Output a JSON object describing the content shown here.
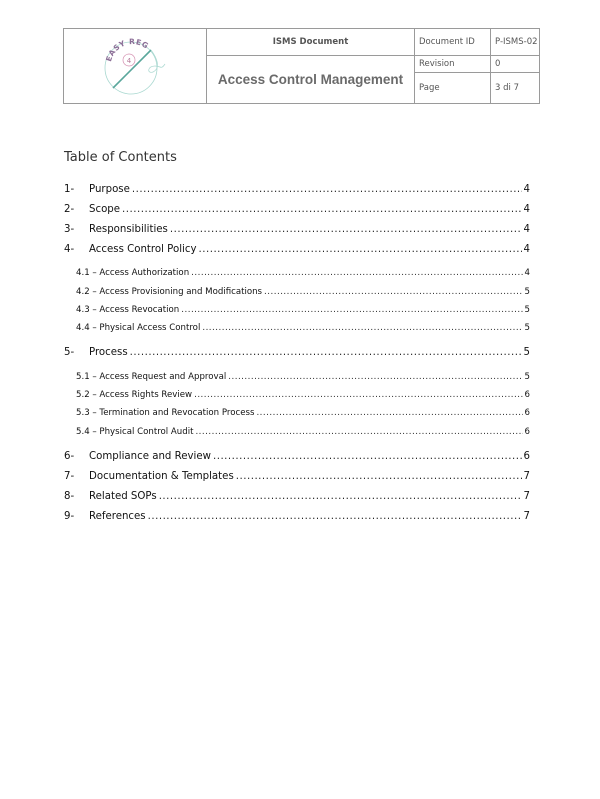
{
  "header": {
    "logo": {
      "icon": "easy-reg-logo-icon",
      "text": "EASY REG",
      "badge": "4",
      "colors": {
        "ring": "#a9d8d0",
        "needle": "#5aa79c",
        "text": "#8b6d96",
        "badge": "#d58fb0"
      }
    },
    "doc_type": "ISMS Document",
    "doc_title": "Access Control Management",
    "fields": [
      {
        "label": "Document ID",
        "value": "P-ISMS-02"
      },
      {
        "label": "Revision",
        "value": "0"
      },
      {
        "label": "Page",
        "value": "3 di 7"
      }
    ]
  },
  "toc": {
    "title": "Table of Contents",
    "entries": [
      {
        "level": 1,
        "number": "1-",
        "text": "Purpose",
        "page": "4"
      },
      {
        "level": 1,
        "number": "2-",
        "text": "Scope",
        "page": "4"
      },
      {
        "level": 1,
        "number": "3-",
        "text": "Responsibilities",
        "page": "4"
      },
      {
        "level": 1,
        "number": "4-",
        "text": "Access Control Policy",
        "page": "4"
      },
      {
        "level": 2,
        "number": "",
        "text": "4.1 – Access Authorization",
        "page": "4"
      },
      {
        "level": 2,
        "number": "",
        "text": "4.2 – Access Provisioning and Modifications",
        "page": "5"
      },
      {
        "level": 2,
        "number": "",
        "text": "4.3 – Access Revocation",
        "page": "5"
      },
      {
        "level": 2,
        "number": "",
        "text": "4.4 – Physical Access Control",
        "page": "5"
      },
      {
        "level": 1,
        "number": "5-",
        "text": "Process",
        "page": "5"
      },
      {
        "level": 2,
        "number": "",
        "text": "5.1 – Access Request and Approval",
        "page": "5"
      },
      {
        "level": 2,
        "number": "",
        "text": "5.2 – Access Rights Review",
        "page": "6"
      },
      {
        "level": 2,
        "number": "",
        "text": "5.3 – Termination and Revocation Process",
        "page": "6"
      },
      {
        "level": 2,
        "number": "",
        "text": "5.4 – Physical Control Audit",
        "page": "6"
      },
      {
        "level": 1,
        "number": "6-",
        "text": "Compliance and Review",
        "page": "6"
      },
      {
        "level": 1,
        "number": "7-",
        "text": "Documentation & Templates",
        "page": "7"
      },
      {
        "level": 1,
        "number": "8-",
        "text": "Related SOPs",
        "page": "7"
      },
      {
        "level": 1,
        "number": "9-",
        "text": "References",
        "page": "7"
      }
    ]
  }
}
